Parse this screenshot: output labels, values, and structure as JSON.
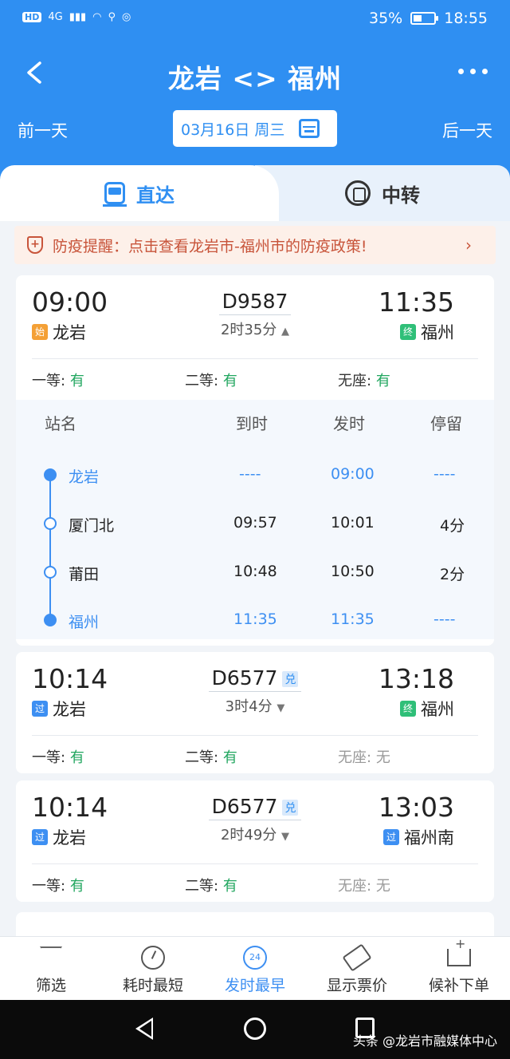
{
  "status": {
    "network": "4G",
    "hd": "HD",
    "battery": "35%",
    "time": "18:55"
  },
  "header": {
    "title": "龙岩 <> 福州"
  },
  "date_bar": {
    "prev": "前一天",
    "date": "03月16日 周三",
    "next": "后一天"
  },
  "tabs": {
    "direct": "直达",
    "transfer": "中转"
  },
  "notice": {
    "text": "防疫提醒：点击查看龙岩市-福州市的防疫政策!",
    "arrow": "›"
  },
  "trains": [
    {
      "dep_time": "09:00",
      "train_no": "D9587",
      "dui": "",
      "duration": "2时35分",
      "duration_arrow": "▲",
      "arr_time": "11:35",
      "from_badge": "始",
      "from": "龙岩",
      "to_badge": "终",
      "to": "福州",
      "seats": [
        {
          "label": "一等:",
          "value": "有"
        },
        {
          "label": "二等:",
          "value": "有"
        },
        {
          "label": "无座:",
          "value": "有"
        }
      ],
      "stops_header": {
        "name": "站名",
        "arrive": "到时",
        "depart": "发时",
        "stay": "停留"
      },
      "stops": [
        {
          "name": "龙岩",
          "arrive": "----",
          "depart": "09:00",
          "stay": "----"
        },
        {
          "name": "厦门北",
          "arrive": "09:57",
          "depart": "10:01",
          "stay": "4分"
        },
        {
          "name": "莆田",
          "arrive": "10:48",
          "depart": "10:50",
          "stay": "2分"
        },
        {
          "name": "福州",
          "arrive": "11:35",
          "depart": "11:35",
          "stay": "----"
        }
      ]
    },
    {
      "dep_time": "10:14",
      "train_no": "D6577",
      "dui": "兑",
      "duration": "3时4分",
      "duration_arrow": "▼",
      "arr_time": "13:18",
      "from_badge": "过",
      "from": "龙岩",
      "to_badge": "终",
      "to": "福州",
      "seats": [
        {
          "label": "一等:",
          "value": "有"
        },
        {
          "label": "二等:",
          "value": "有"
        },
        {
          "label": "无座:",
          "value": "无"
        }
      ]
    },
    {
      "dep_time": "10:14",
      "train_no": "D6577",
      "dui": "兑",
      "duration": "2时49分",
      "duration_arrow": "▼",
      "arr_time": "13:03",
      "from_badge": "过",
      "from": "龙岩",
      "to_badge": "过",
      "to": "福州南",
      "seats": [
        {
          "label": "一等:",
          "value": "有"
        },
        {
          "label": "二等:",
          "value": "有"
        },
        {
          "label": "无座:",
          "value": "无"
        }
      ]
    }
  ],
  "bottom_nav": [
    {
      "label": "筛选"
    },
    {
      "label": "耗时最短"
    },
    {
      "label": "发时最早",
      "icon_text": "24"
    },
    {
      "label": "显示票价"
    },
    {
      "label": "候补下单"
    }
  ],
  "watermark": "头条 @龙岩市融媒体中心",
  "colors": {
    "primary": "#2f8ff2",
    "available": "#21a65f",
    "notice": "#c8543a"
  }
}
